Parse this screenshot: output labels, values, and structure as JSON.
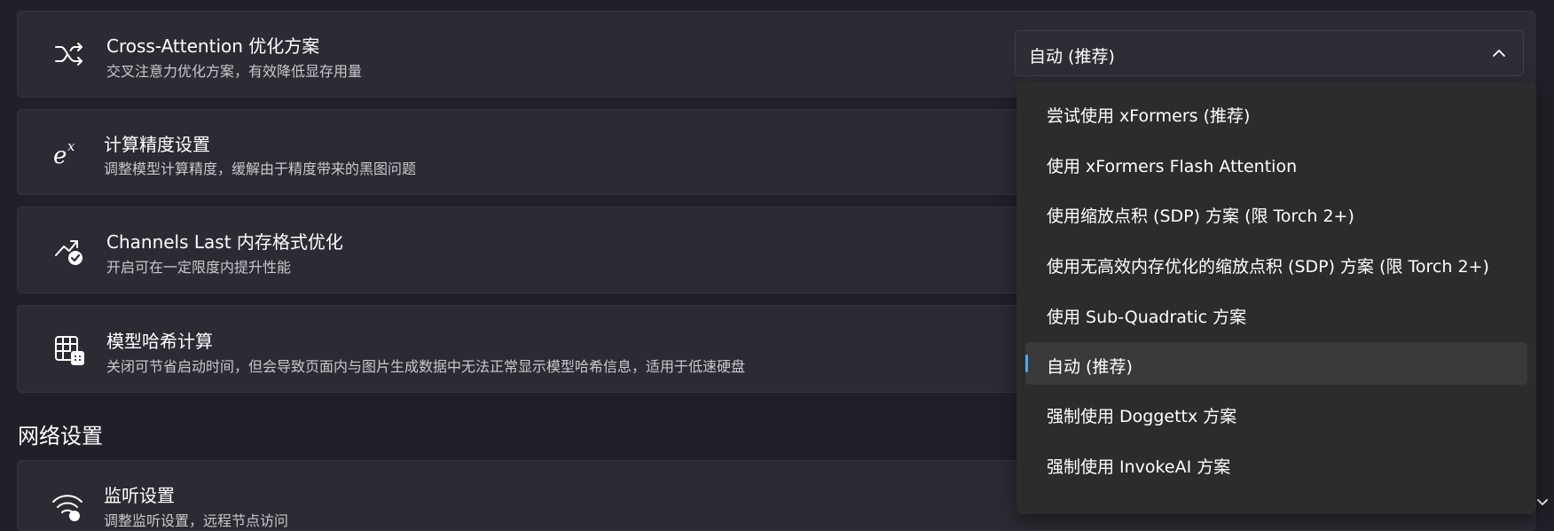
{
  "settings": [
    {
      "title": "Cross-Attention 优化方案",
      "description": "交叉注意力优化方案，有效降低显存用量",
      "icon": "shuffle-icon",
      "value": "自动 (推荐)"
    },
    {
      "title": "计算精度设置",
      "description": "调整模型计算精度，缓解由于精度带来的黑图问题",
      "icon": "exponent-icon"
    },
    {
      "title": "Channels Last 内存格式优化",
      "description": "开启可在一定限度内提升性能",
      "icon": "trend-up-check-icon"
    },
    {
      "title": "模型哈希计算",
      "description": "关闭可节省启动时间，但会导致页面内与图片生成数据中无法正常显示模型哈希信息，适用于低速硬盘",
      "icon": "table-calculator-icon"
    }
  ],
  "network": {
    "section_title": "网络设置",
    "items": [
      {
        "title": "监听设置",
        "description": "调整监听设置，远程节点访问",
        "icon": "wifi-gear-icon"
      }
    ]
  },
  "dropdown": {
    "options": [
      "尝试使用 xFormers (推荐)",
      "使用 xFormers Flash Attention",
      "使用缩放点积 (SDP) 方案 (限 Torch 2+)",
      "使用无高效内存优化的缩放点积 (SDP) 方案 (限 Torch 2+)",
      "使用 Sub-Quadratic 方案",
      "自动 (推荐)",
      "强制使用 Doggettx 方案",
      "强制使用 InvokeAI 方案"
    ],
    "selected_index": 5,
    "accent_color": "#4ea8f2"
  }
}
